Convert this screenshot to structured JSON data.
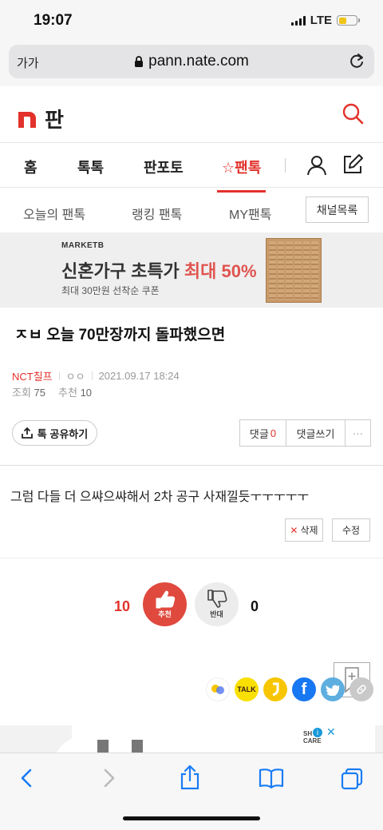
{
  "status": {
    "time": "19:07",
    "network": "LTE",
    "battery_color": "#f0c419"
  },
  "browser": {
    "text_size_label": "가가",
    "url": "pann.nate.com"
  },
  "site": {
    "logo_text": "판",
    "brand_color": "#e2322b"
  },
  "nav": {
    "items": [
      "홈",
      "톡톡",
      "판포토",
      "☆팬톡"
    ],
    "active_index": 3
  },
  "subnav": {
    "items": [
      "오늘의 팬톡",
      "랭킹 팬톡",
      "MY팬톡"
    ],
    "channel_button": "채널목록"
  },
  "ad": {
    "brand": "MARKETB",
    "headline": "신혼가구 초특가 ",
    "headline_accent": "최대 50%",
    "subline": "최대 30만원 선착순 쿠폰"
  },
  "post": {
    "title": "ㅈㅂ 오늘 70만장까지 돌파했으면",
    "writer": "NCT칠프",
    "writer_mark": "ㅇㅇ",
    "date": "2021.09.17 18:24",
    "views_label": "조회",
    "views": "75",
    "recommend_label": "추천",
    "recommend": "10",
    "body": "그럼 다들 더 으쌰으쌰해서 2차 공구 사재낄듯ㅜㅜㅜㅜㅜ"
  },
  "actions": {
    "share_label": "톡 공유하기",
    "comments_label": "댓글",
    "comments_count": "0",
    "write_comment_label": "댓글쓰기",
    "more_label": "···",
    "delete_label": "삭제",
    "edit_label": "수정"
  },
  "votes": {
    "up_count": "10",
    "up_label": "추천",
    "down_label": "반대",
    "down_count": "0"
  },
  "share_icons": {
    "kakaotalk_label": "TALK"
  },
  "bottom_ad": {
    "mark": "SH\nCARE"
  }
}
